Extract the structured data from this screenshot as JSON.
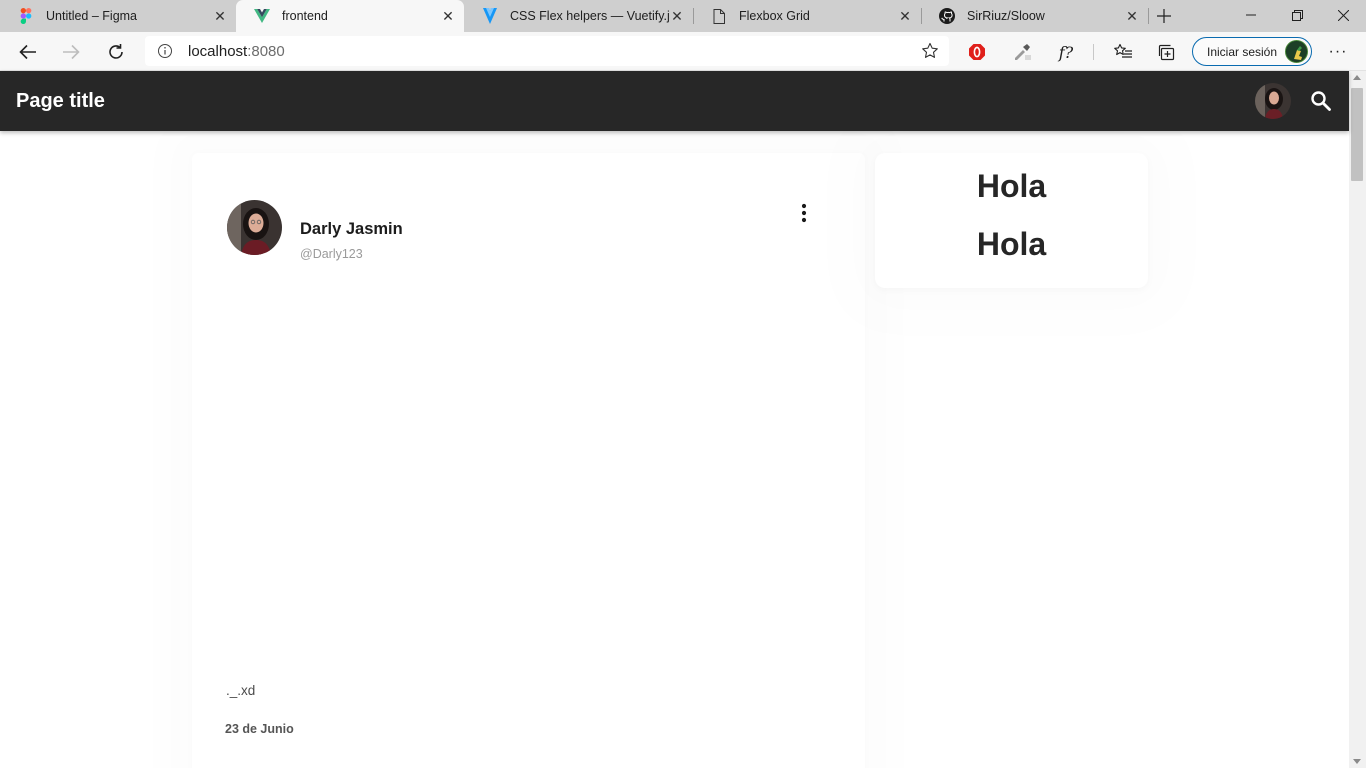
{
  "browser": {
    "tabs": [
      {
        "title": "Untitled – Figma",
        "icon": "figma-icon",
        "active": false
      },
      {
        "title": "frontend",
        "icon": "vue-icon",
        "active": true
      },
      {
        "title": "CSS Flex helpers — Vuetify.js",
        "icon": "vuetify-icon",
        "active": false
      },
      {
        "title": "Flexbox Grid",
        "icon": "page-icon",
        "active": false
      },
      {
        "title": "SirRiuz/Sloow",
        "icon": "github-icon",
        "active": false
      }
    ],
    "url_host": "localhost",
    "url_port": ":8080",
    "signin_label": "Iniciar sesión",
    "accent": "#0a6bb0"
  },
  "appbar": {
    "title": "Page title",
    "background": "#272727"
  },
  "post": {
    "author_name": "Darly Jasmin",
    "author_handle": "@Darly123",
    "text": "._.xd",
    "date": "23 de Junio"
  },
  "side_card": {
    "lines": [
      "Hola",
      "Hola"
    ]
  }
}
